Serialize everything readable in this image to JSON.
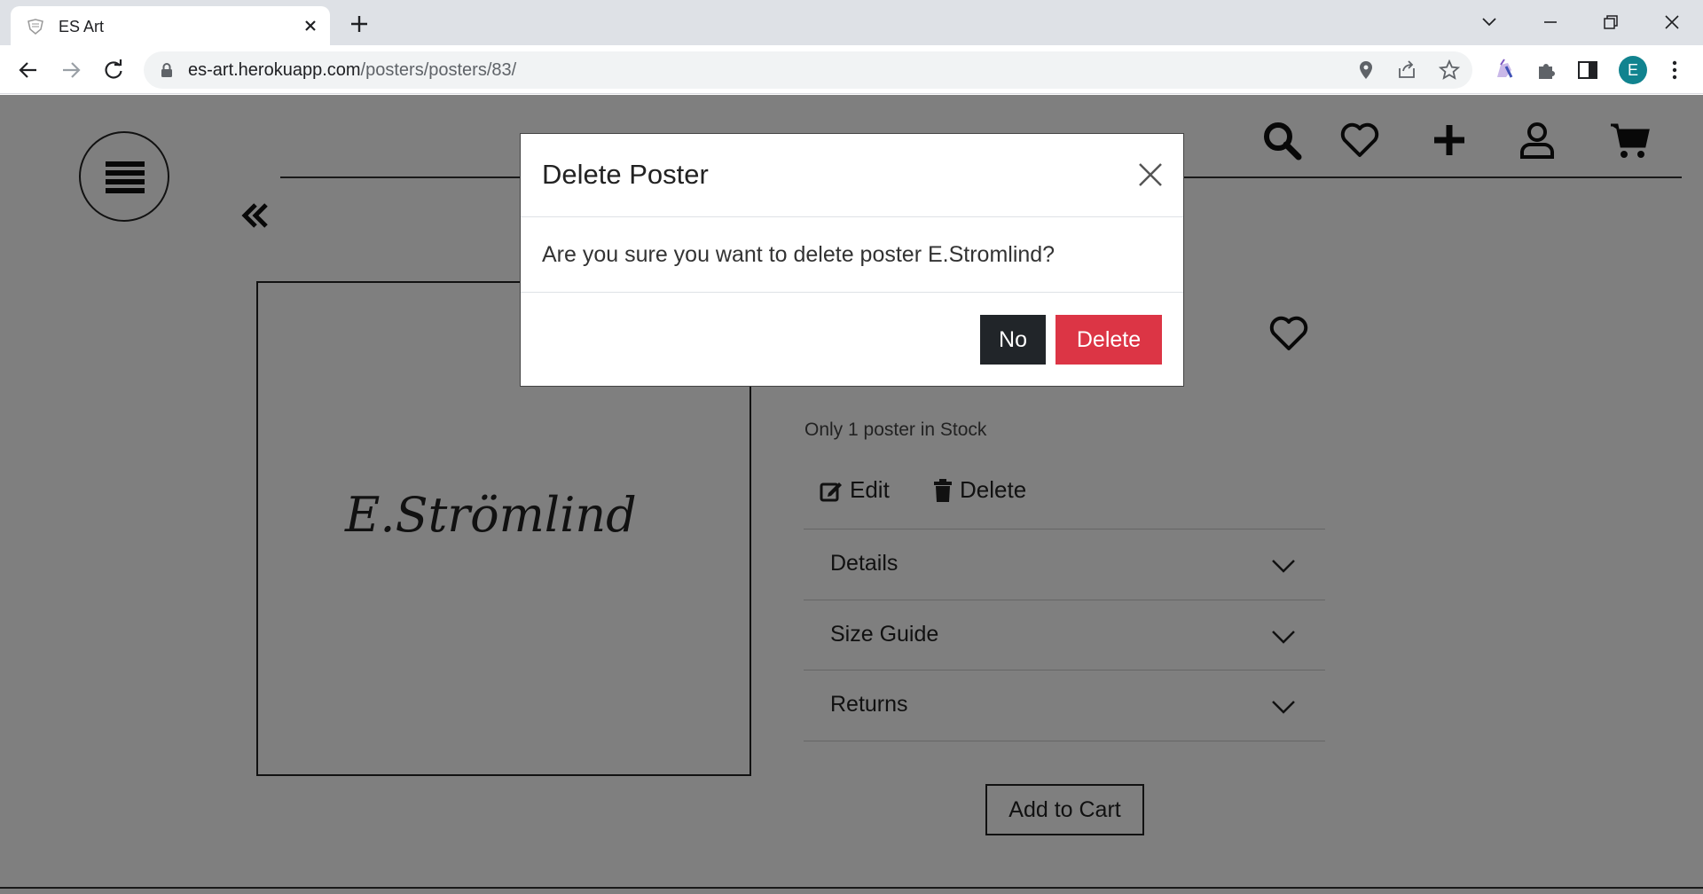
{
  "browser": {
    "tab_title": "ES Art",
    "url_domain": "es-art.herokuapp.com",
    "url_path": "/posters/posters/83/",
    "profile_initial": "E",
    "profile_color": "#11838f"
  },
  "poster": {
    "signature_text": "E.Strömlind",
    "stock_text": "Only 1 poster in Stock",
    "edit_label": "Edit",
    "delete_label": "Delete",
    "accordion": [
      {
        "label": "Details"
      },
      {
        "label": "Size Guide"
      },
      {
        "label": "Returns"
      }
    ],
    "add_to_cart_label": "Add to Cart"
  },
  "modal": {
    "title": "Delete Poster",
    "message": "Are you sure you want to delete poster E.Stromlind?",
    "no_label": "No",
    "delete_label": "Delete",
    "delete_color": "#dc3545",
    "no_color": "#212529"
  },
  "icons": {
    "header": [
      "search-icon",
      "heart-icon",
      "plus-icon",
      "user-icon",
      "cart-icon"
    ]
  }
}
